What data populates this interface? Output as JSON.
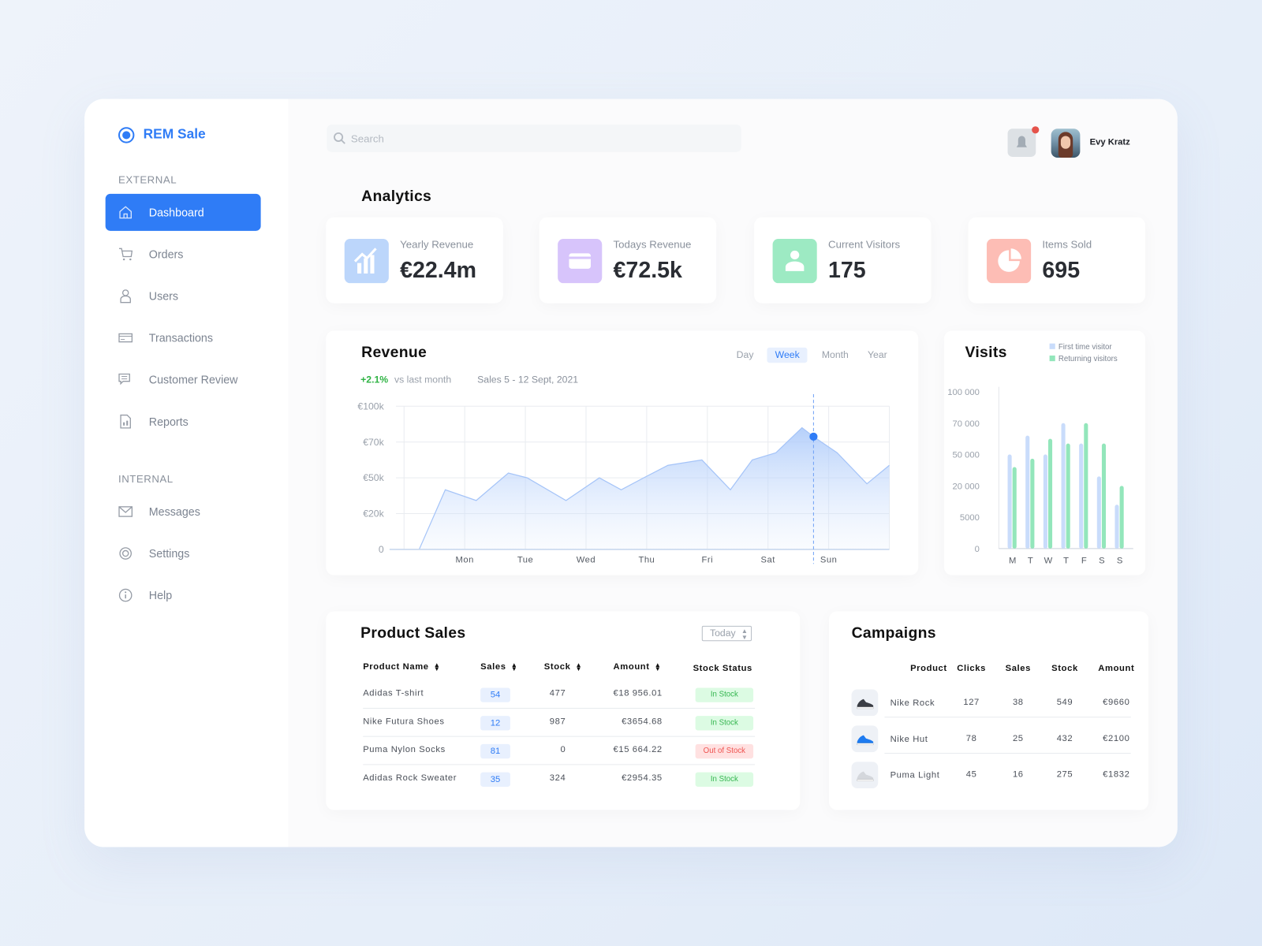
{
  "app": {
    "name": "REM Sale",
    "brand_color": "#2f7cf6"
  },
  "sidebar": {
    "sections": [
      {
        "label": "EXTERNAL",
        "items": [
          {
            "label": "Dashboard",
            "icon": "home-icon",
            "active": true
          },
          {
            "label": "Orders",
            "icon": "cart-icon"
          },
          {
            "label": "Users",
            "icon": "user-icon"
          },
          {
            "label": "Transactions",
            "icon": "card-icon"
          },
          {
            "label": "Customer Review",
            "icon": "chat-icon"
          },
          {
            "label": "Reports",
            "icon": "report-icon"
          }
        ]
      },
      {
        "label": "INTERNAL",
        "items": [
          {
            "label": "Messages",
            "icon": "mail-icon"
          },
          {
            "label": "Settings",
            "icon": "gear-icon"
          },
          {
            "label": "Help",
            "icon": "info-icon"
          }
        ]
      }
    ]
  },
  "header": {
    "search_placeholder": "Search",
    "user_name": "Evy Kratz",
    "notification": true
  },
  "analytics": {
    "title": "Analytics",
    "stats": [
      {
        "label": "Yearly Revenue",
        "value": "€22.4m",
        "icon": "chart-up-icon",
        "color": "#bcd6fb"
      },
      {
        "label": "Todays Revenue",
        "value": "€72.5k",
        "icon": "credit-card-icon",
        "color": "#d7c4fb"
      },
      {
        "label": "Current Visitors",
        "value": "175",
        "icon": "user-icon",
        "color": "#9deac3"
      },
      {
        "label": "Items Sold",
        "value": "695",
        "icon": "pie-chart-icon",
        "color": "#fdbdb5"
      }
    ]
  },
  "revenue": {
    "title": "Revenue",
    "change": "+2.1%",
    "change_label": "vs last month",
    "range": "Sales 5 - 12 Sept, 2021",
    "tabs": [
      "Day",
      "Week",
      "Month",
      "Year"
    ],
    "active_tab": "Week"
  },
  "visits": {
    "title": "Visits"
  },
  "chart_data": [
    {
      "type": "area",
      "categories": [
        "Mon",
        "Tue",
        "Wed",
        "Thu",
        "Fri",
        "Sat",
        "Sun"
      ],
      "y_ticks": [
        "0",
        "€20k",
        "€50k",
        "€70k",
        "€100k"
      ],
      "y_tick_values": [
        0,
        20000,
        50000,
        70000,
        100000
      ],
      "x_note": "x in day units, Mon=1",
      "points": [
        [
          0.25,
          0
        ],
        [
          0.68,
          40000
        ],
        [
          1.19,
          31000
        ],
        [
          1.72,
          52700
        ],
        [
          2.03,
          50000
        ],
        [
          2.67,
          31000
        ],
        [
          3.22,
          50000
        ],
        [
          3.58,
          40000
        ],
        [
          3.95,
          50000
        ],
        [
          4.35,
          57000
        ],
        [
          4.91,
          60000
        ],
        [
          5.38,
          40000
        ],
        [
          5.74,
          60000
        ],
        [
          6.13,
          64000
        ],
        [
          6.56,
          82000
        ],
        [
          6.75,
          74500
        ],
        [
          7.14,
          64000
        ],
        [
          7.63,
          45000
        ],
        [
          8.0,
          57000
        ]
      ],
      "highlight_x": 6.75,
      "grid": true,
      "color": "#2f7cf6"
    },
    {
      "type": "bar",
      "categories": [
        "M",
        "T",
        "W",
        "T",
        "F",
        "S",
        "S"
      ],
      "y_ticks": [
        "0",
        "5000",
        "20 000",
        "50 000",
        "70 000",
        "100 000"
      ],
      "y_tick_values": [
        0,
        5000,
        20000,
        50000,
        70000,
        100000
      ],
      "legend_position": "top-right",
      "series": [
        {
          "name": "First time visitor",
          "color": "#c9dcfb",
          "values": [
            50000,
            62000,
            50000,
            70000,
            57000,
            29000,
            11000
          ]
        },
        {
          "name": "Returning visitors",
          "color": "#93e6bb",
          "values": [
            38000,
            46000,
            60000,
            57000,
            70000,
            57000,
            20000
          ]
        }
      ]
    }
  ],
  "product_sales": {
    "title": "Product Sales",
    "filter": "Today",
    "columns": [
      "Product Name",
      "Sales",
      "Stock",
      "Amount",
      "Stock Status"
    ],
    "rows": [
      {
        "name": "Adidas T-shirt",
        "sales": "54",
        "stock": "477",
        "amount": "€18 956.01",
        "status": "In Stock"
      },
      {
        "name": "Nike Futura Shoes",
        "sales": "12",
        "stock": "987",
        "amount": "€3654.68",
        "status": "In Stock"
      },
      {
        "name": "Puma Nylon Socks",
        "sales": "81",
        "stock": "0",
        "amount": "€15 664.22",
        "status": "Out of Stock"
      },
      {
        "name": "Adidas Rock Sweater",
        "sales": "35",
        "stock": "324",
        "amount": "€2954.35",
        "status": "In Stock"
      }
    ]
  },
  "campaigns": {
    "title": "Campaigns",
    "columns": [
      "Product",
      "Clicks",
      "Sales",
      "Stock",
      "Amount"
    ],
    "rows": [
      {
        "product": "Nike Rock",
        "clicks": "127",
        "sales": "38",
        "stock": "549",
        "amount": "€9660",
        "shoe_color": "#3a3d44"
      },
      {
        "product": "Nike Hut",
        "clicks": "78",
        "sales": "25",
        "stock": "432",
        "amount": "€2100",
        "shoe_color": "#1e7bf0"
      },
      {
        "product": "Puma Light",
        "clicks": "45",
        "sales": "16",
        "stock": "275",
        "amount": "€1832",
        "shoe_color": "#d4d7dc"
      }
    ]
  }
}
